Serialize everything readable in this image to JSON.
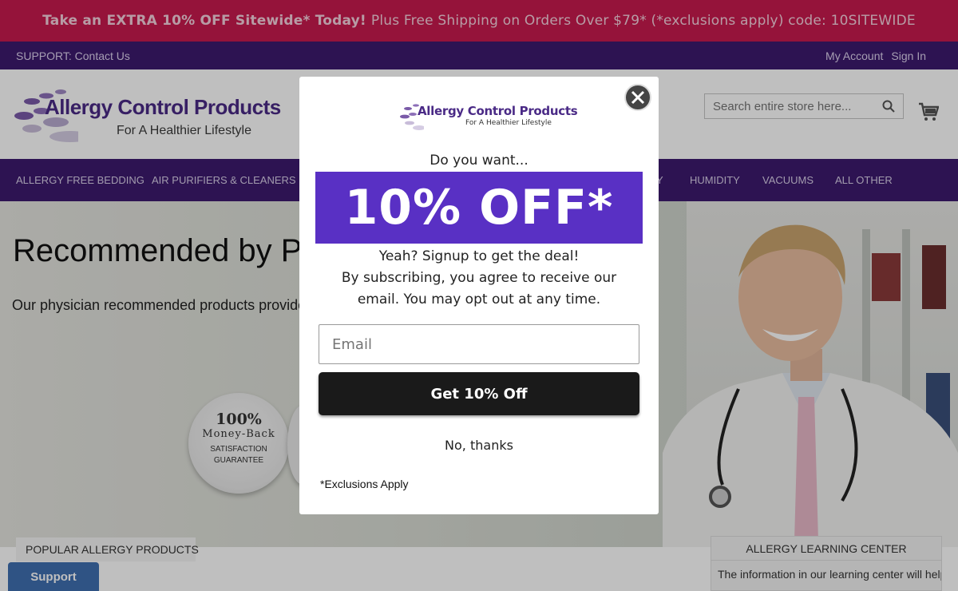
{
  "promo": {
    "bold": "Take an EXTRA 10% OFF Sitewide* Today!",
    "rest": "Plus Free Shipping on Orders Over $79* (*exclusions apply) code: 10SITEWIDE"
  },
  "utility": {
    "support": "SUPPORT: Contact Us",
    "my_account": "My Account",
    "sign_in": "Sign In"
  },
  "header": {
    "logo_title": "Allergy Control Products",
    "logo_tagline": "For A Healthier Lifestyle",
    "search_placeholder": "Search entire store here..."
  },
  "nav": {
    "items": [
      "ALLERGY FREE BEDDING",
      "AIR PURIFIERS & CLEANERS",
      "Y",
      "HUMIDITY",
      "VACUUMS",
      "ALL OTHER"
    ]
  },
  "hero": {
    "heading": "Recommended by Ph",
    "subtext": "Our physician recommended products provide",
    "badge": {
      "line1": "100%",
      "line2": "Money-Back",
      "line3": "SATISFACTION",
      "line4": "GUARANTEE"
    }
  },
  "sections": {
    "popular": "POPULAR ALLERGY PRODUCTS",
    "learning_title": "ALLERGY LEARNING CENTER",
    "learning_text": "The information in our learning center will help you find ways to reduce the",
    "support_button": "Support"
  },
  "modal": {
    "logo_title": "Allergy Control Products",
    "logo_tagline": "For A Healthier Lifestyle",
    "question": "Do you want...",
    "offer": "10% OFF*",
    "line1": "Yeah? Signup to get the deal!",
    "line2": "By subscribing, you agree to receive our",
    "line3": "email. You may opt out at any time.",
    "email_placeholder": "Email",
    "cta": "Get 10% Off",
    "decline": "No, thanks",
    "exclusions": "*Exclusions Apply"
  },
  "colors": {
    "promo_bg": "#c71a4e",
    "brand_purple": "#3d1a6e",
    "offer_bg": "#5930c4",
    "cta_bg": "#1a1a1a",
    "support_bg": "#3f6fb0"
  }
}
